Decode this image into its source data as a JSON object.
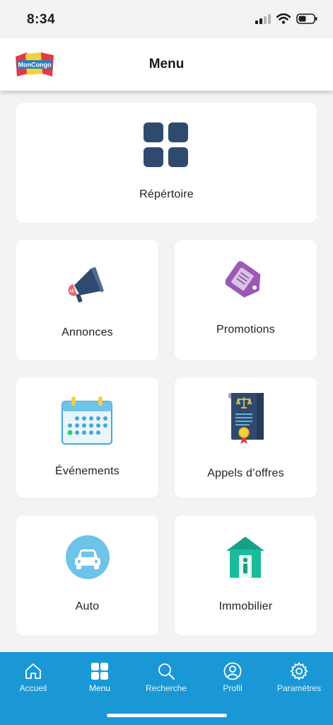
{
  "status_bar": {
    "time": "8:34"
  },
  "header": {
    "logo_text": "MonCongo",
    "title": "Menu"
  },
  "menu": {
    "repertoire": {
      "label": "Répértoire",
      "icon": "grid-icon"
    },
    "annonces": {
      "label": "Annonces",
      "icon": "megaphone-icon"
    },
    "promotions": {
      "label": "Promotions",
      "icon": "price-tag-icon"
    },
    "evenements": {
      "label": "Événements",
      "icon": "calendar-icon"
    },
    "appels_offres": {
      "label": "Appels d’offres",
      "icon": "document-scroll-icon"
    },
    "auto": {
      "label": "Auto",
      "icon": "car-icon"
    },
    "immobilier": {
      "label": "Immobilier",
      "icon": "house-icon"
    }
  },
  "tab_bar": {
    "accueil": "Accueil",
    "menu": "Menu",
    "recherche": "Recherche",
    "profil": "Profil",
    "parametres": "Paramètres"
  },
  "colors": {
    "tab_bar": "#1998d5",
    "grid_icon": "#2f4a6e",
    "promo_tag": "#9b59b6",
    "auto_circle": "#4aa3df",
    "house": "#1abc9c"
  }
}
